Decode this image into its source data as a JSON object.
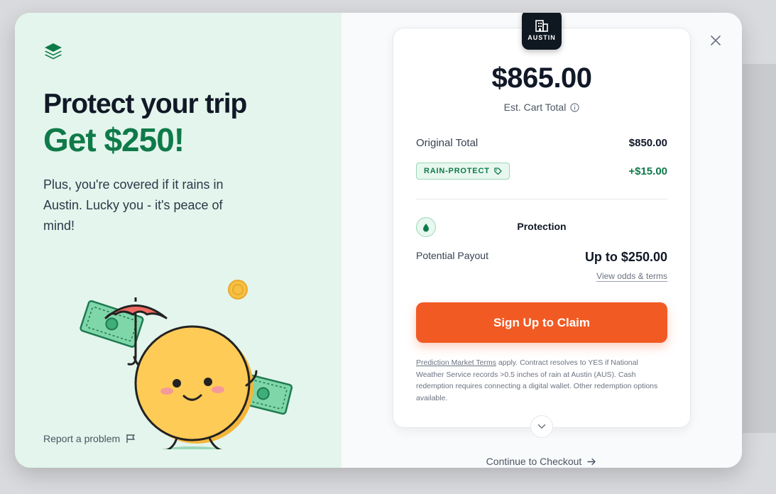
{
  "left_panel": {
    "headline": "Protect your trip",
    "headline_accent": "Get $250!",
    "subtext": "Plus, you're covered if it rains in Austin. Lucky you - it's peace of mind!",
    "report_label": "Report a problem",
    "icons": {
      "logo": "layers-icon",
      "report": "flag-icon",
      "illustration": "coin-mascot-with-umbrella"
    }
  },
  "card": {
    "city_badge": "AUSTIN",
    "total_amount": "$865.00",
    "total_label": "Est. Cart Total",
    "original_total_label": "Original Total",
    "original_total_value": "$850.00",
    "promo_code": "RAIN-PROTECT",
    "promo_value": "+$15.00",
    "protection_title": "Protection",
    "payout_label": "Potential Payout",
    "payout_value": "Up to $250.00",
    "odds_link": "View odds & terms",
    "cta_label": "Sign Up to Claim",
    "fineprint_link": "Prediction Market Terms",
    "fineprint_text": " apply. Contract resolves to YES if National Weather Service records >0.5 inches of rain at Austin (AUS). Cash redemption requires connecting a digital wallet. Other redemption options available."
  },
  "continue_label": "Continue to Checkout",
  "colors": {
    "accent_green": "#0f7a49",
    "cta_orange": "#f25a24",
    "left_panel_bg": "#e3f5ec"
  }
}
